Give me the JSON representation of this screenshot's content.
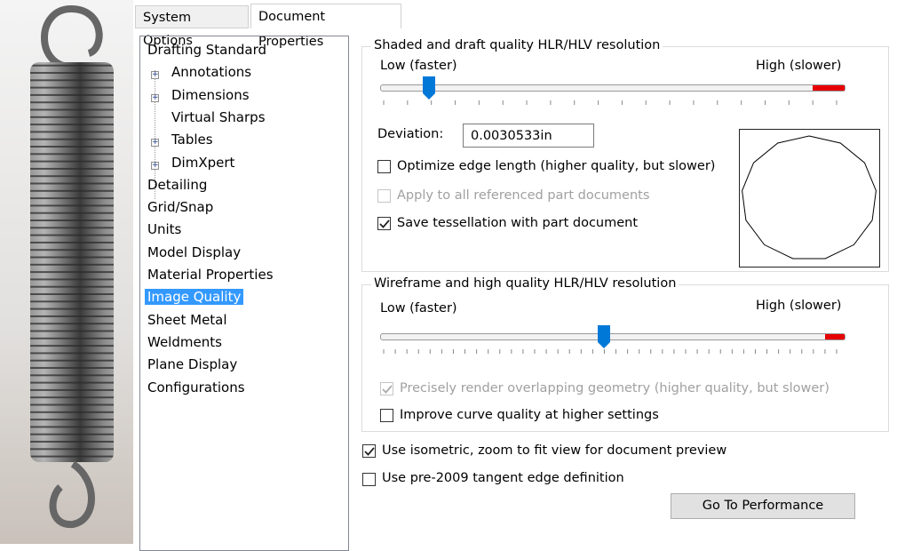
{
  "tabs": [
    {
      "label": "System Options",
      "active": false
    },
    {
      "label": "Document Properties",
      "active": true
    }
  ],
  "tree": {
    "items": [
      {
        "label": "Drafting Standard",
        "level": 0
      },
      {
        "label": "Annotations",
        "level": 1,
        "expandable": true
      },
      {
        "label": "Dimensions",
        "level": 1,
        "expandable": true
      },
      {
        "label": "Virtual Sharps",
        "level": 1,
        "expandable": false
      },
      {
        "label": "Tables",
        "level": 1,
        "expandable": true
      },
      {
        "label": "DimXpert",
        "level": 1,
        "expandable": true
      },
      {
        "label": "Detailing",
        "level": 0
      },
      {
        "label": "Grid/Snap",
        "level": 0
      },
      {
        "label": "Units",
        "level": 0
      },
      {
        "label": "Model Display",
        "level": 0
      },
      {
        "label": "Material Properties",
        "level": 0
      },
      {
        "label": "Image Quality",
        "level": 0,
        "selected": true
      },
      {
        "label": "Sheet Metal",
        "level": 0
      },
      {
        "label": "Weldments",
        "level": 0
      },
      {
        "label": "Plane Display",
        "level": 0
      },
      {
        "label": "Configurations",
        "level": 0
      }
    ]
  },
  "shaded": {
    "title": "Shaded and draft quality HLR/HLV resolution",
    "low": "Low (faster)",
    "high": "High (slower)",
    "slider_fraction": 0.105,
    "deviation_label": "Deviation:",
    "deviation_value": "0.0030533in",
    "optimize": {
      "label": "Optimize edge length (higher quality, but slower)",
      "checked": false
    },
    "apply_all": {
      "label": "Apply to all referenced part documents",
      "checked": false,
      "disabled": true
    },
    "save_tess": {
      "label": "Save tessellation with part document",
      "checked": true
    }
  },
  "wireframe": {
    "title": "Wireframe and high quality HLR/HLV resolution",
    "low": "Low (faster)",
    "high": "High (slower)",
    "slider_fraction": 0.48,
    "precise": {
      "label": "Precisely render overlapping geometry (higher quality, but slower)",
      "checked": true,
      "disabled": true
    },
    "improve": {
      "label": "Improve curve quality at higher settings",
      "checked": false
    }
  },
  "isometric": {
    "label": "Use isometric, zoom to fit view for document preview",
    "checked": true
  },
  "pre2009": {
    "label": "Use pre-2009 tangent edge definition",
    "checked": false
  },
  "go_perf": "Go To Performance",
  "colors": {
    "accent": "#0078d7",
    "selection": "#3399ff",
    "slider_limit": "#e60000"
  }
}
